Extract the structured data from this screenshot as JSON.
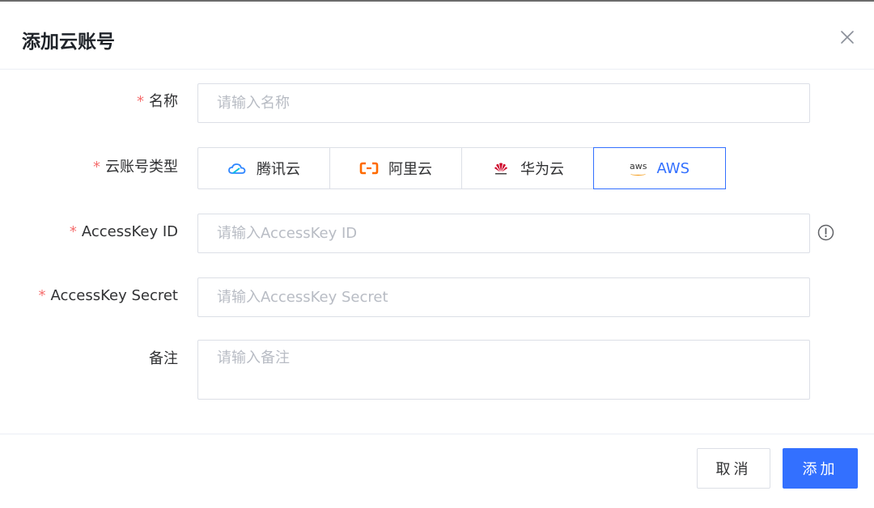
{
  "dialog": {
    "title": "添加云账号"
  },
  "form": {
    "name": {
      "required_mark": "*",
      "label": "名称",
      "placeholder": "请输入名称",
      "value": ""
    },
    "cloud_type": {
      "required_mark": "*",
      "label": "云账号类型",
      "options": [
        {
          "label": "腾讯云",
          "icon": "tencent-cloud-icon",
          "color": "#2e86ff"
        },
        {
          "label": "阿里云",
          "icon": "aliyun-icon",
          "color": "#ff6a00"
        },
        {
          "label": "华为云",
          "icon": "huawei-cloud-icon",
          "color": "#cf0a2c"
        },
        {
          "label": "AWS",
          "icon": "aws-icon",
          "icon_text": "aws",
          "color": "#f29100"
        }
      ],
      "selected": "AWS"
    },
    "access_key_id": {
      "required_mark": "*",
      "label": "AccessKey ID",
      "placeholder": "请输入AccessKey ID",
      "value": ""
    },
    "access_key_secret": {
      "required_mark": "*",
      "label": "AccessKey Secret",
      "placeholder": "请输入AccessKey Secret",
      "value": ""
    },
    "remark": {
      "label": "备注",
      "placeholder": "请输入备注",
      "value": ""
    }
  },
  "footer": {
    "cancel_label": "取消",
    "submit_label": "添加"
  },
  "colors": {
    "primary": "#3370ff",
    "required": "#f56c6c",
    "border": "#dcdfe6"
  }
}
